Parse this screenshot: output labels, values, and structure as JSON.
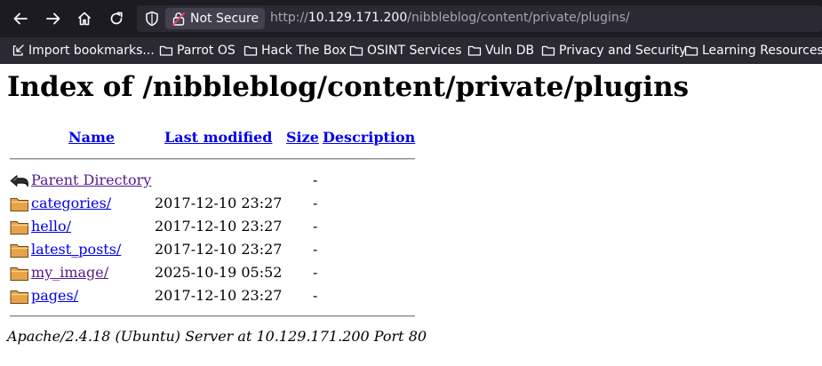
{
  "browser": {
    "security_label": "Not Secure",
    "url_prefix": "http://",
    "url_host": "10.129.171.200",
    "url_path": "/nibbleblog/content/private/plugins/",
    "bookmarks": [
      "Import bookmarks...",
      "Parrot OS",
      "Hack The Box",
      "OSINT Services",
      "Vuln DB",
      "Privacy and Security",
      "Learning Resources"
    ]
  },
  "page": {
    "title": "Index of /nibbleblog/content/private/plugins",
    "columns": {
      "name": "Name",
      "modified": "Last modified",
      "size": "Size",
      "description": "Description"
    },
    "parent": {
      "name": "Parent Directory",
      "size": "-"
    },
    "entries": [
      {
        "name": "categories/",
        "modified": "2017-12-10 23:27",
        "size": "-",
        "visited": false
      },
      {
        "name": "hello/",
        "modified": "2017-12-10 23:27",
        "size": "-",
        "visited": false
      },
      {
        "name": "latest_posts/",
        "modified": "2017-12-10 23:27",
        "size": "-",
        "visited": false
      },
      {
        "name": "my_image/",
        "modified": "2025-10-19 05:52",
        "size": "-",
        "visited": true
      },
      {
        "name": "pages/",
        "modified": "2017-12-10 23:27",
        "size": "-",
        "visited": false
      }
    ],
    "footer": "Apache/2.4.18 (Ubuntu) Server at 10.129.171.200 Port 80"
  }
}
